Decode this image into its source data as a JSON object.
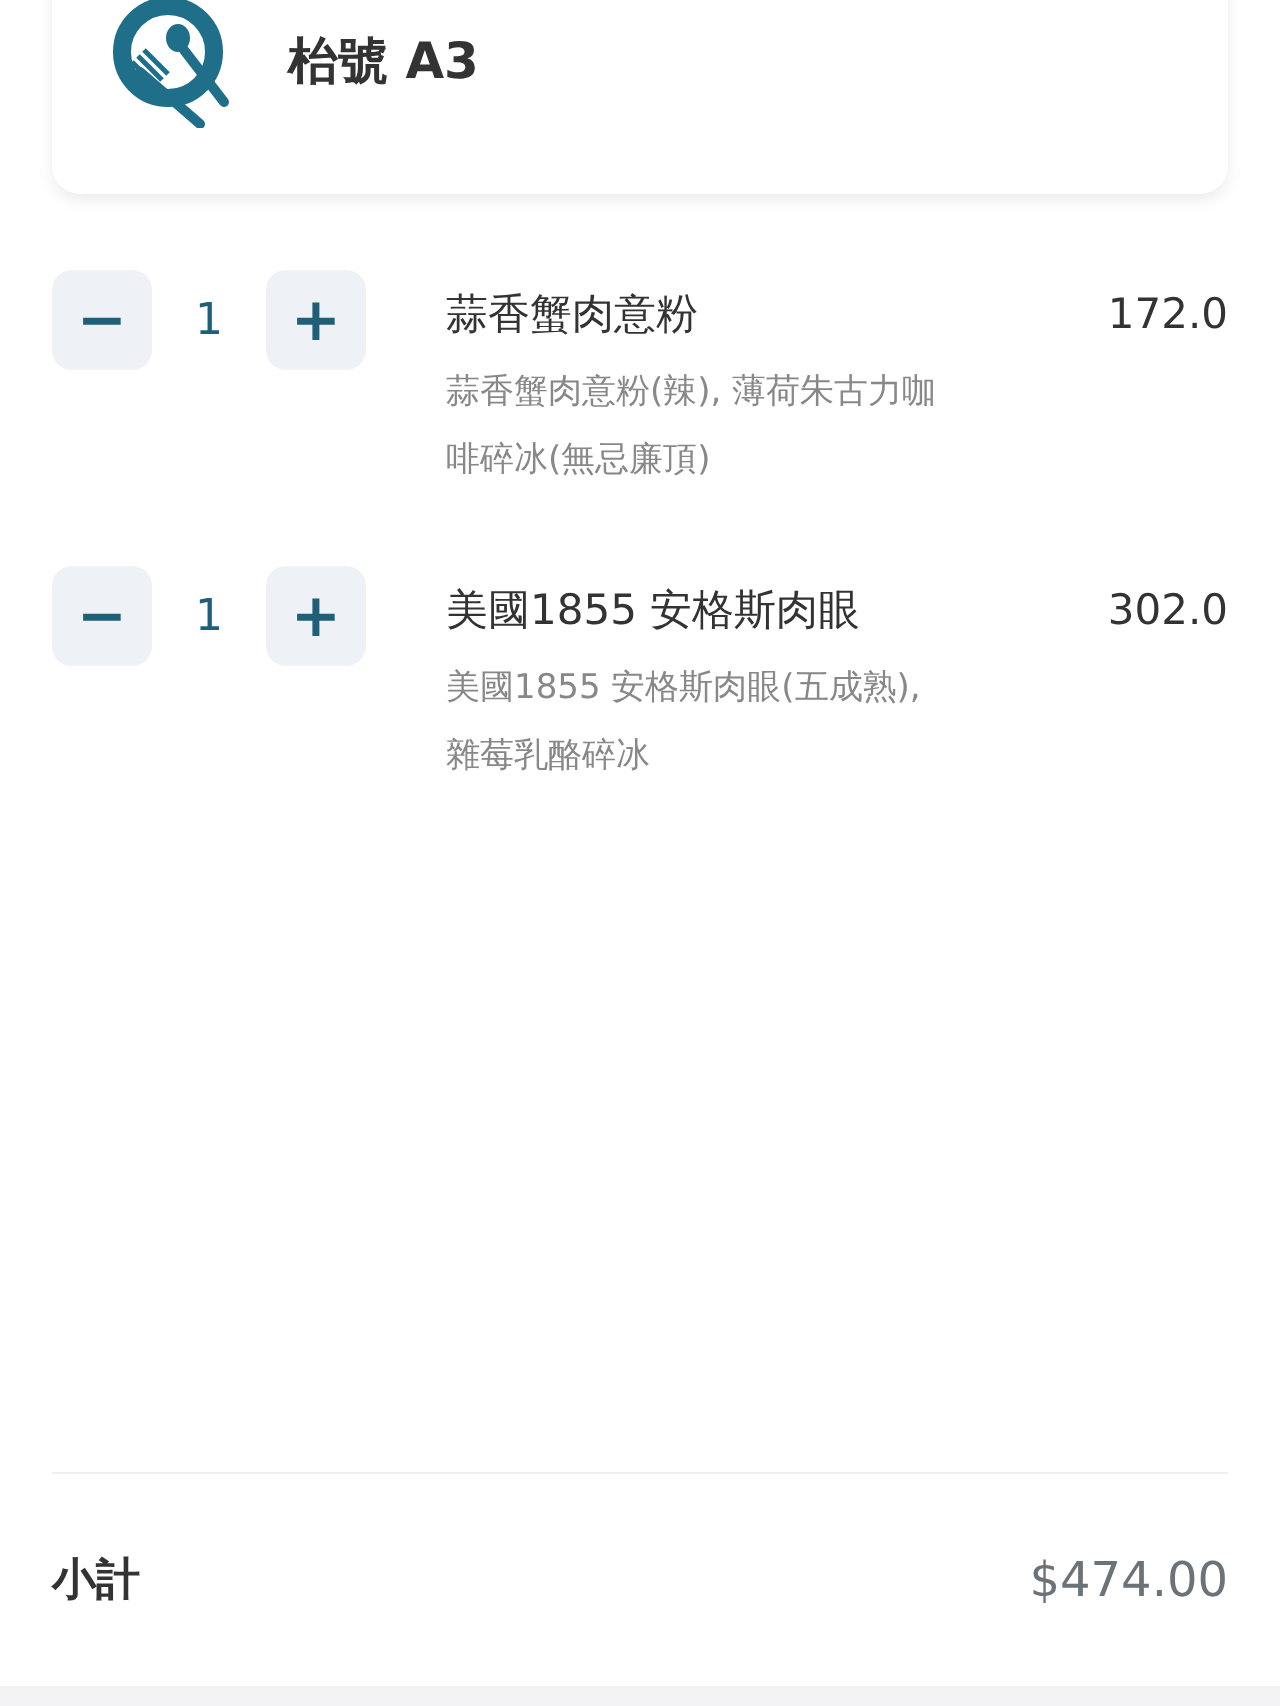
{
  "header": {
    "title": "枱號 A3"
  },
  "items": [
    {
      "minus": "−",
      "quantity": "1",
      "plus": "+",
      "name": "蒜香蟹肉意粉",
      "price": "172.0",
      "details": "蒜香蟹肉意粉(辣), 薄荷朱古力咖啡碎冰(無忌廉頂)"
    },
    {
      "minus": "−",
      "quantity": "1",
      "plus": "+",
      "name": "美國1855 安格斯肉眼",
      "price": "302.0",
      "details": "美國1855 安格斯肉眼(五成熟), 雜莓乳酪碎冰"
    }
  ],
  "subtotal": {
    "label": "小計",
    "amount": "$474.00"
  }
}
